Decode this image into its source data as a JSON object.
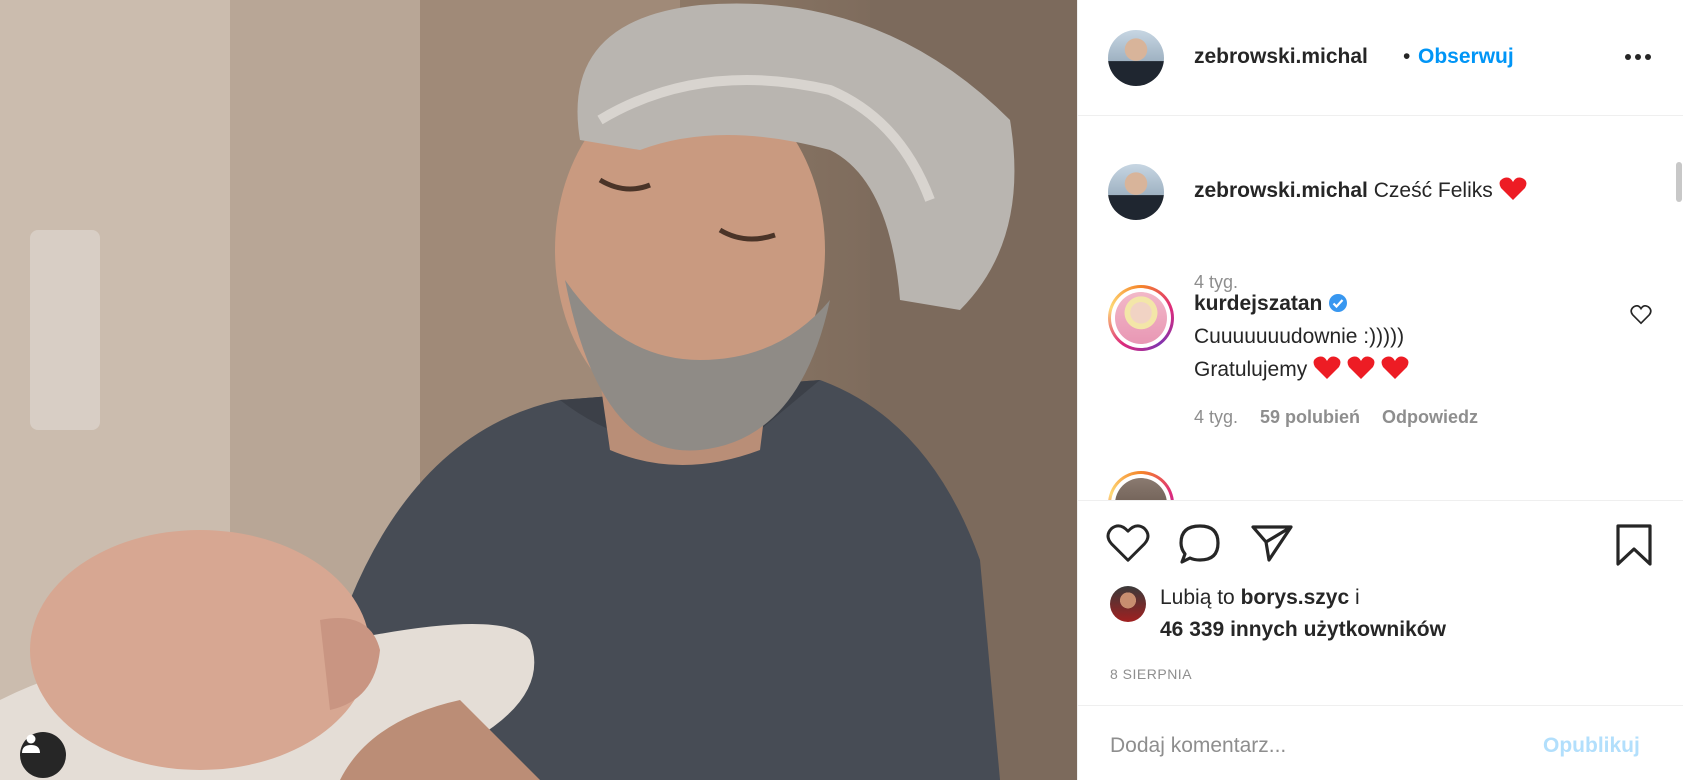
{
  "photo": {
    "alt_icon": "user-tag-icon"
  },
  "header": {
    "username": "zebrowski.michal",
    "separator": "•",
    "follow_label": "Obserwuj",
    "more_icon": "more-options-icon"
  },
  "caption": {
    "username": "zebrowski.michal",
    "text": "Cześć Feliks",
    "time": "4 tyg."
  },
  "comments": [
    {
      "username": "kurdejszatan",
      "verified": true,
      "line1": "Cuuuuuuudownie :)))))",
      "line2": "Gratulujemy",
      "time": "4 tyg.",
      "likes": "59 polubień",
      "reply_label": "Odpowiedz"
    }
  ],
  "actions": {
    "like_icon": "heart-icon",
    "comment_icon": "comment-icon",
    "share_icon": "share-icon",
    "save_icon": "bookmark-icon"
  },
  "likes": {
    "line1_prefix": "Lubią to",
    "liker": "borys.szyc",
    "line1_suffix": "i",
    "line2_count": "46 339 innych użytkowników"
  },
  "date": "8 SIERPNIA",
  "add_comment": {
    "placeholder": "Dodaj komentarz...",
    "publish_label": "Opublikuj"
  },
  "colors": {
    "accent": "#0095f6",
    "heart": "#ed1c24",
    "publish_disabled": "#b2dffc"
  }
}
